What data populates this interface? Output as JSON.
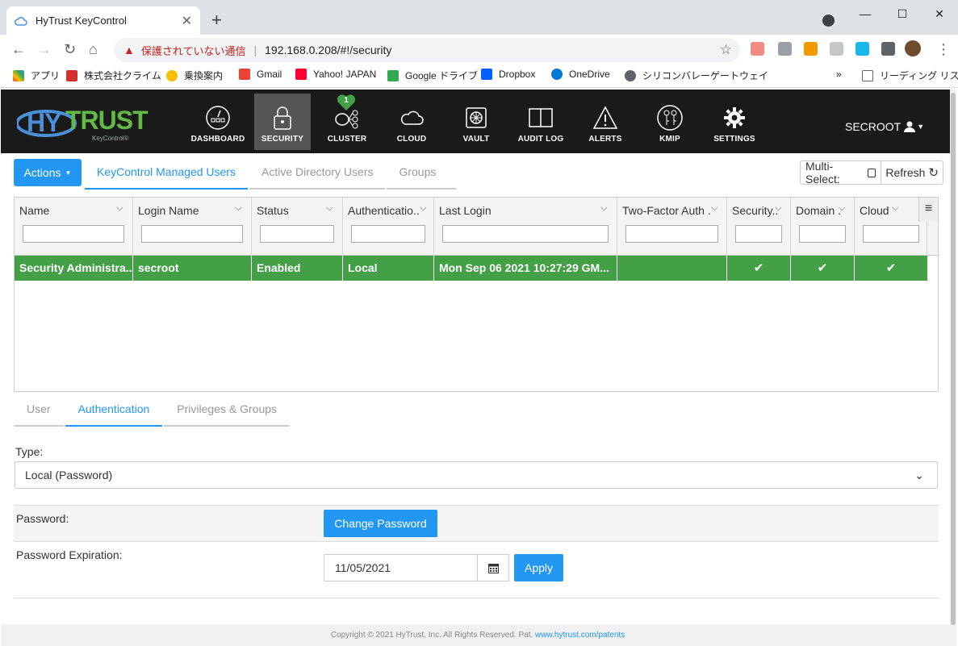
{
  "browser": {
    "tab_title": "HyTrust KeyControl",
    "omnibox": {
      "insecure_label": "保護されていない通信",
      "url": "192.168.0.208/#!/security"
    },
    "bookmarks": [
      {
        "label": "アプリ"
      },
      {
        "label": "株式会社クライム"
      },
      {
        "label": "乗換案内"
      },
      {
        "label": "Gmail"
      },
      {
        "label": "Yahoo! JAPAN"
      },
      {
        "label": "Google ドライブ"
      },
      {
        "label": "Dropbox"
      },
      {
        "label": "OneDrive"
      },
      {
        "label": "シリコンバレーゲートウェイ"
      }
    ],
    "reading_list": "リーディング リスト",
    "more_bookmarks": "»"
  },
  "app": {
    "logo": {
      "hy": "HY",
      "trust": "TRUST",
      "sub": "KeyControl®"
    },
    "nav": [
      {
        "label": "DASHBOARD",
        "icon": "dashboard-icon"
      },
      {
        "label": "SECURITY",
        "icon": "lock-icon",
        "active": true
      },
      {
        "label": "CLUSTER",
        "icon": "cluster-icon",
        "badge": "1"
      },
      {
        "label": "CLOUD",
        "icon": "cloud-icon"
      },
      {
        "label": "VAULT",
        "icon": "vault-icon"
      },
      {
        "label": "AUDIT LOG",
        "icon": "book-icon"
      },
      {
        "label": "ALERTS",
        "icon": "warning-icon"
      },
      {
        "label": "KMIP",
        "icon": "keys-icon"
      },
      {
        "label": "SETTINGS",
        "icon": "gear-icon"
      }
    ],
    "user": "SECROOT"
  },
  "toolbar": {
    "actions_label": "Actions",
    "tabs": [
      {
        "label": "KeyControl Managed Users",
        "active": true
      },
      {
        "label": "Active Directory Users"
      },
      {
        "label": "Groups"
      }
    ],
    "multiselect_label": "Multi-Select:",
    "refresh_label": "Refresh"
  },
  "grid": {
    "columns": [
      "Name",
      "Login Name",
      "Status",
      "Authenticatio...",
      "Last Login",
      "Two-Factor Auth ...",
      "Security...",
      "Domain ...",
      "Cloud"
    ],
    "rows": [
      {
        "name": "Security Administra...",
        "login": "secroot",
        "status": "Enabled",
        "auth": "Local",
        "last_login": "Mon Sep 06 2021 10:27:29 GM...",
        "two_factor": "",
        "security": "✔",
        "domain": "✔",
        "cloud": "✔"
      }
    ]
  },
  "details": {
    "tabs": [
      {
        "label": "User"
      },
      {
        "label": "Authentication",
        "active": true
      },
      {
        "label": "Privileges & Groups"
      }
    ],
    "type_label": "Type:",
    "type_value": "Local (Password)",
    "password_label": "Password:",
    "change_password_label": "Change Password",
    "expiration_label": "Password Expiration:",
    "expiration_value": "11/05/2021",
    "apply_label": "Apply"
  },
  "footer": {
    "text": "Copyright © 2021 HyTrust, Inc. All Rights Reserved. Pat.",
    "link": "www.hytrust.com/patents"
  },
  "colors": {
    "accent": "#2196f3",
    "selected_row": "#43a047",
    "header_bg": "#1a1a1a"
  }
}
